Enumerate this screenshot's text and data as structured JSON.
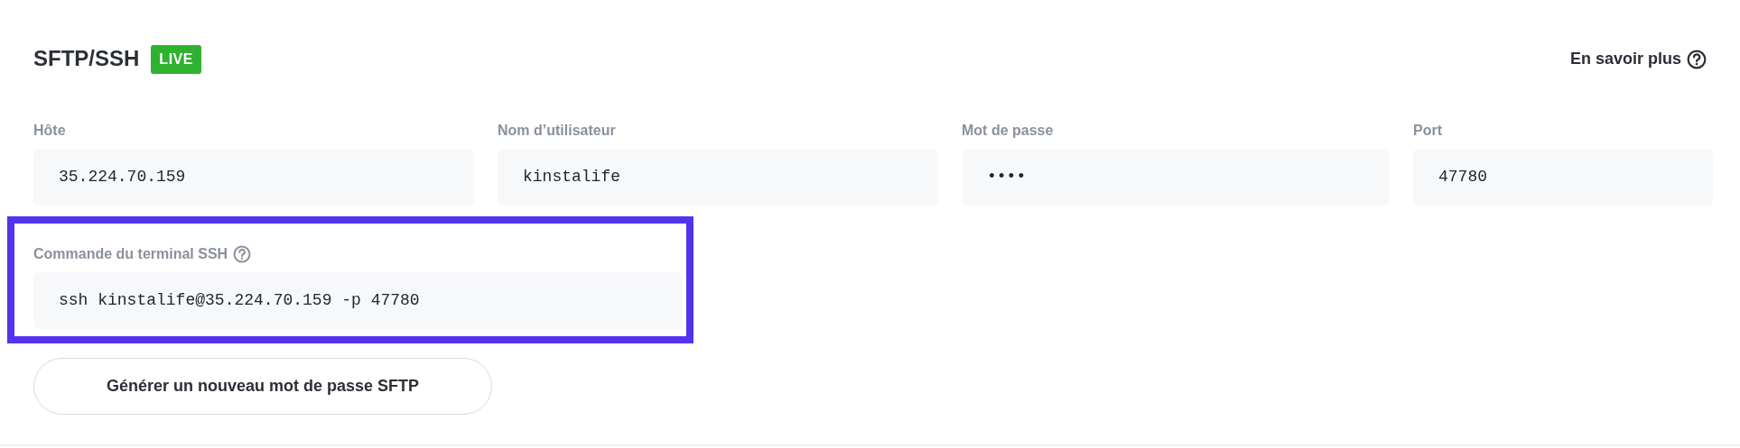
{
  "header": {
    "title": "SFTP/SSH",
    "badge": "LIVE",
    "help_link": "En savoir plus"
  },
  "fields": [
    {
      "label": "Hôte",
      "value": "35.224.70.159"
    },
    {
      "label": "Nom d’utilisateur",
      "value": "kinstalife"
    },
    {
      "label": "Mot de passe",
      "value": "••••"
    },
    {
      "label": "Port",
      "value": "47780"
    }
  ],
  "command": {
    "label": "Commande du terminal SSH",
    "value": "ssh kinstalife@35.224.70.159 -p 47780",
    "highlighted": true
  },
  "button": {
    "label": "Générer un nouveau mot de passe SFTP"
  }
}
